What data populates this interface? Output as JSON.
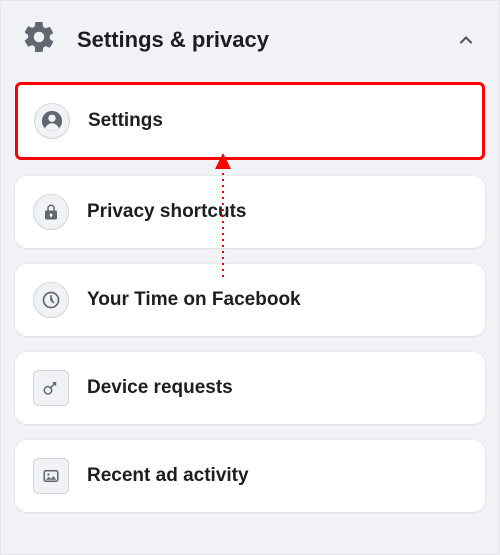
{
  "header": {
    "title": "Settings & privacy"
  },
  "items": [
    {
      "label": "Settings",
      "icon": "profile-icon",
      "highlighted": true
    },
    {
      "label": "Privacy shortcuts",
      "icon": "lock-icon"
    },
    {
      "label": "Your Time on Facebook",
      "icon": "clock-icon"
    },
    {
      "label": "Device requests",
      "icon": "key-icon"
    },
    {
      "label": "Recent ad activity",
      "icon": "photo-icon"
    }
  ],
  "colors": {
    "highlight_border": "#ff0000",
    "card_bg": "#ffffff",
    "page_bg": "#f0f2f5"
  }
}
